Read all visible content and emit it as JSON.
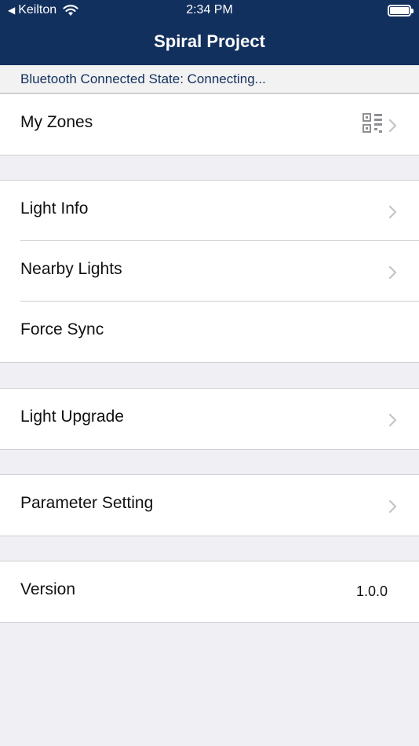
{
  "status_bar": {
    "back_app": "Keilton",
    "time": "2:34 PM"
  },
  "nav": {
    "title": "Spiral Project"
  },
  "bluetooth": {
    "status": "Bluetooth Connected State: Connecting..."
  },
  "rows": {
    "my_zones": "My Zones",
    "light_info": "Light Info",
    "nearby_lights": "Nearby Lights",
    "force_sync": "Force Sync",
    "light_upgrade": "Light Upgrade",
    "parameter_setting": "Parameter Setting",
    "version": "Version",
    "version_value": "1.0.0"
  }
}
